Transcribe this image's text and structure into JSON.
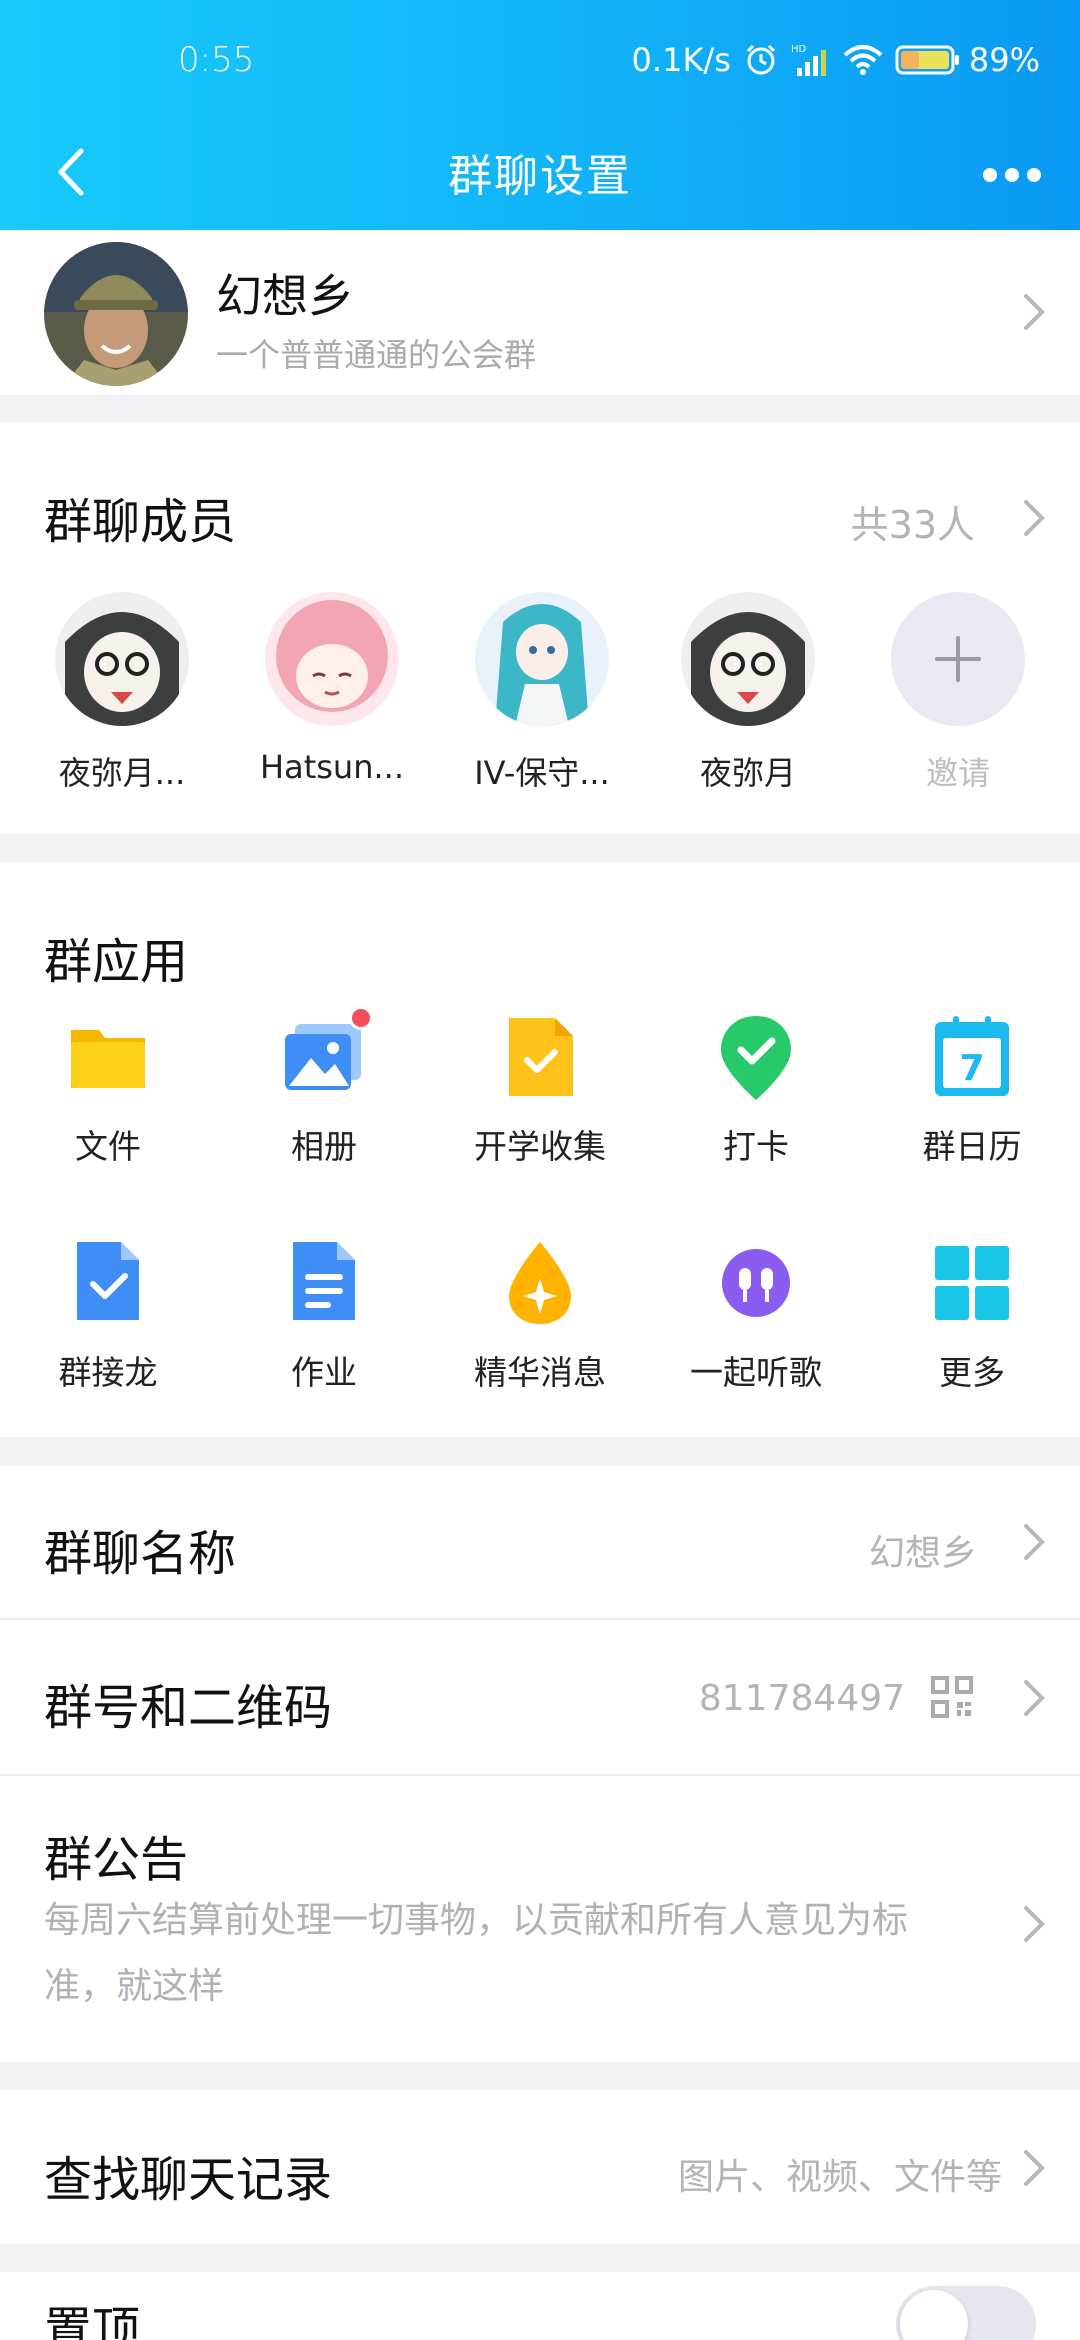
{
  "status": {
    "time": "0:55",
    "speed": "0.1K/s",
    "battery": "89%",
    "hd": "HD"
  },
  "header": {
    "title": "群聊设置"
  },
  "group": {
    "name": "幻想乡",
    "desc": "一个普普通通的公会群"
  },
  "members": {
    "title": "群聊成员",
    "count": "共33人",
    "items": [
      {
        "name": "夜弥月..."
      },
      {
        "name": "Hatsun..."
      },
      {
        "name": "IV-保守..."
      },
      {
        "name": "夜弥月"
      }
    ],
    "invite": "邀请"
  },
  "apps": {
    "title": "群应用",
    "items": [
      {
        "label": "文件",
        "icon": "folder-icon"
      },
      {
        "label": "相册",
        "icon": "album-icon"
      },
      {
        "label": "开学收集",
        "icon": "collect-icon"
      },
      {
        "label": "打卡",
        "icon": "checkin-icon"
      },
      {
        "label": "群日历",
        "icon": "calendar-icon"
      },
      {
        "label": "群接龙",
        "icon": "relay-icon"
      },
      {
        "label": "作业",
        "icon": "homework-icon"
      },
      {
        "label": "精华消息",
        "icon": "essence-icon"
      },
      {
        "label": "一起听歌",
        "icon": "music-icon"
      },
      {
        "label": "更多",
        "icon": "more-apps-icon"
      }
    ],
    "calendar_day": "7"
  },
  "settings": {
    "name": {
      "label": "群聊名称",
      "value": "幻想乡"
    },
    "number": {
      "label": "群号和二维码",
      "value": "811784497"
    },
    "notice": {
      "label": "群公告",
      "value": "每周六结算前处理一切事物，以贡献和所有人意见为标准，就这样"
    },
    "search": {
      "label": "查找聊天记录",
      "value": "图片、视频、文件等"
    },
    "pin": {
      "label": "置顶",
      "enabled": false
    }
  },
  "colors": {
    "accent": "#12b5f8",
    "badge": "#f74c5c"
  }
}
